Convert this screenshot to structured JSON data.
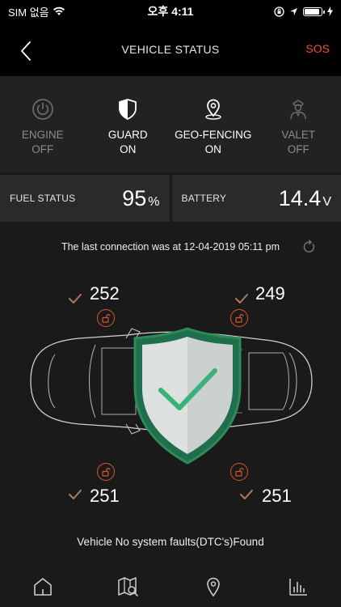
{
  "status_bar": {
    "carrier": "SIM 없음",
    "time": "오후 4:11"
  },
  "nav": {
    "title": "VEHICLE STATUS",
    "sos_label": "SOS"
  },
  "modes": [
    {
      "line1": "ENGINE",
      "line2": "OFF"
    },
    {
      "line1": "GUARD",
      "line2": "ON"
    },
    {
      "line1": "GEO-FENCING",
      "line2": "ON"
    },
    {
      "line1": "VALET",
      "line2": "OFF"
    }
  ],
  "fuel": {
    "label": "FUEL STATUS",
    "value": "95",
    "unit": "%"
  },
  "battery": {
    "label": "BATTERY",
    "value": "14.4",
    "unit": "V"
  },
  "connection_text": "The last connection was at 12-04-2019 05:11 pm",
  "tires": {
    "front_left": "252",
    "front_right": "249",
    "rear_left": "251",
    "rear_right": "251"
  },
  "fault_text": "Vehicle No system faults(DTC's)Found",
  "colors": {
    "accent": "#e8542b",
    "shield_green": "#2e8b57",
    "check_green": "#3ab07a",
    "check_brown": "#b07a5e"
  }
}
